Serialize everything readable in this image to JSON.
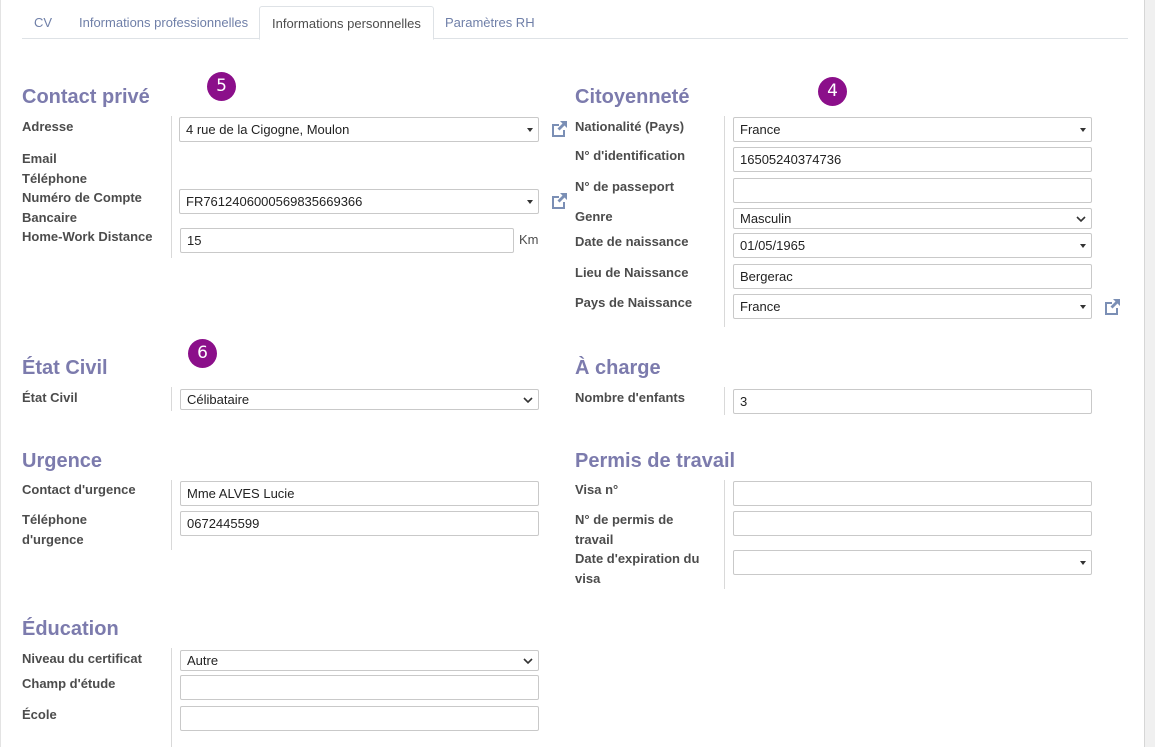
{
  "tabs": [
    {
      "label": "CV"
    },
    {
      "label": "Informations professionnelles"
    },
    {
      "label": "Informations personnelles",
      "active": true
    },
    {
      "label": "Paramètres RH"
    }
  ],
  "badges": {
    "contact": "5",
    "citizenship": "4",
    "civil": "6"
  },
  "contact": {
    "title": "Contact privé",
    "address_label": "Adresse",
    "address_value": "4 rue de la Cigogne, Moulon",
    "email_label": "Email",
    "phone_label": "Téléphone",
    "bank_label_1": "Numéro de Compte",
    "bank_label_2": "Bancaire",
    "bank_value": "FR7612406000569835669366",
    "distance_label": "Home-Work Distance",
    "distance_value": "15",
    "distance_unit": "Km"
  },
  "citizenship": {
    "title": "Citoyenneté",
    "nationality_label": "Nationalité (Pays)",
    "nationality_value": "France",
    "id_label": "N° d'identification",
    "id_value": "16505240374736",
    "passport_label": "N° de passeport",
    "passport_value": "",
    "gender_label": "Genre",
    "gender_value": "Masculin",
    "birthdate_label": "Date de naissance",
    "birthdate_value": "01/05/1965",
    "birthplace_label": "Lieu de Naissance",
    "birthplace_value": "Bergerac",
    "birthcountry_label": "Pays de Naissance",
    "birthcountry_value": "France"
  },
  "civil": {
    "title": "État Civil",
    "status_label": "État Civil",
    "status_value": "Célibataire"
  },
  "dependents": {
    "title": "À charge",
    "children_label": "Nombre d'enfants",
    "children_value": "3"
  },
  "emergency": {
    "title": "Urgence",
    "contact_label": "Contact d'urgence",
    "contact_value": "Mme ALVES Lucie",
    "phone_label_1": "Téléphone",
    "phone_label_2": "d'urgence",
    "phone_value": "0672445599"
  },
  "work_permit": {
    "title": "Permis de travail",
    "visa_label": "Visa n°",
    "visa_value": "",
    "permit_label_1": "N° de permis de",
    "permit_label_2": "travail",
    "permit_value": "",
    "expiry_label_1": "Date d'expiration du",
    "expiry_label_2": "visa",
    "expiry_value": ""
  },
  "education": {
    "title": "Éducation",
    "level_label": "Niveau du certificat",
    "level_value": "Autre",
    "field_label": "Champ d'étude",
    "field_value": "",
    "school_label": "École",
    "school_value": ""
  }
}
